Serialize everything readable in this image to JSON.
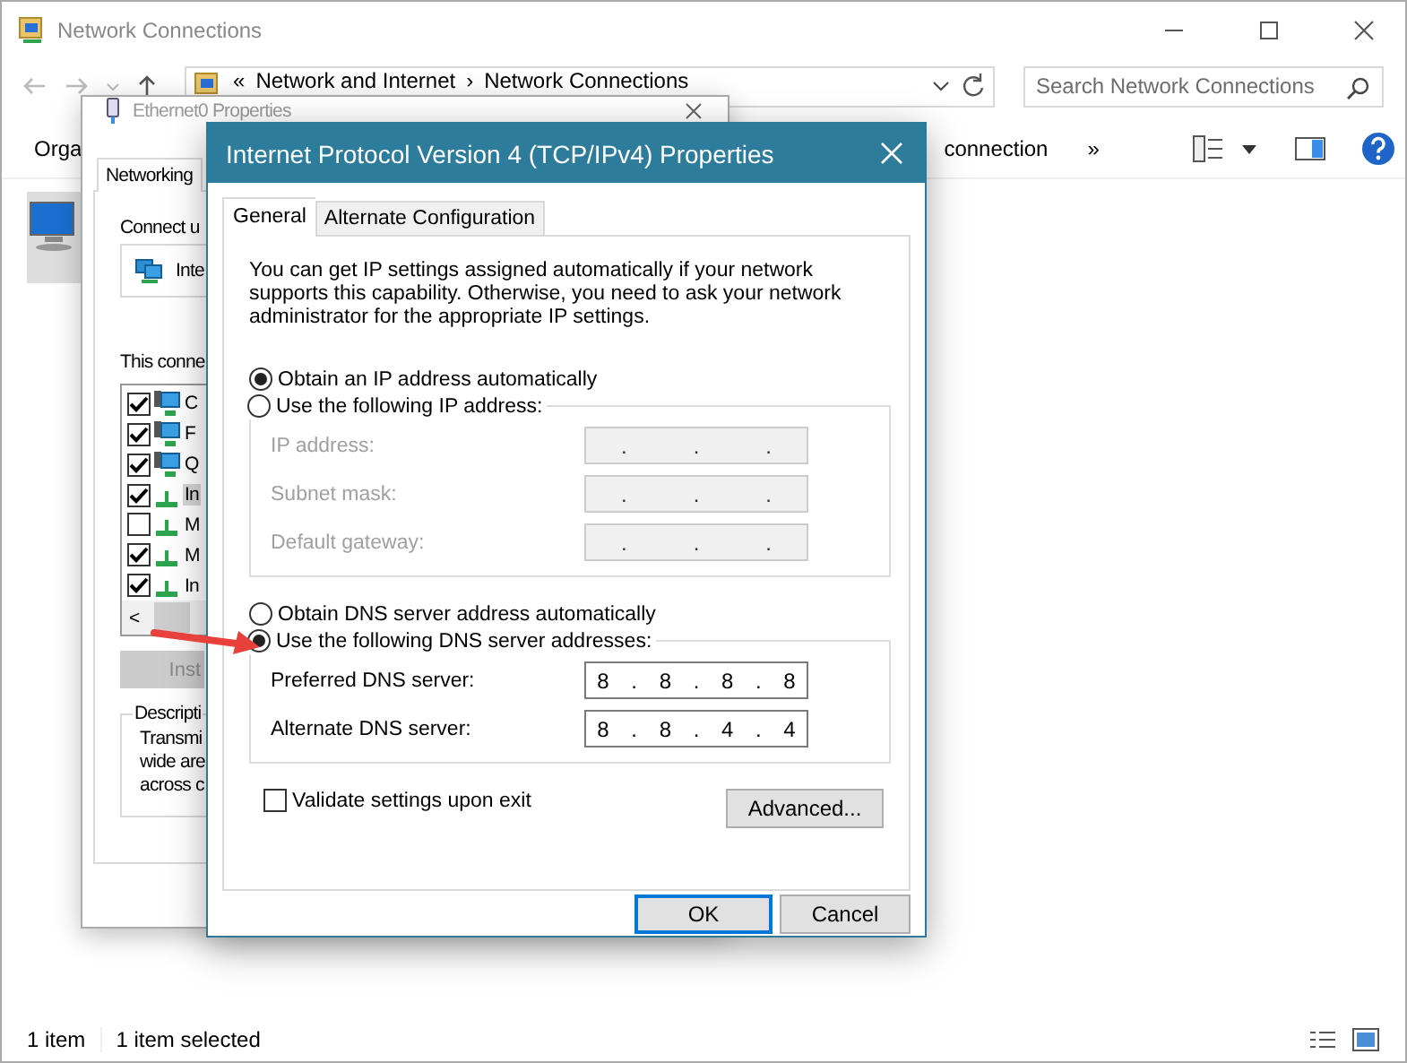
{
  "explorer": {
    "title": "Network Connections",
    "breadcrumb": [
      "«",
      "Network and Internet",
      "›",
      "Network Connections"
    ],
    "search": {
      "placeholder": "Search Network Connections"
    },
    "toolbar": [
      "Orga",
      "connection",
      "»"
    ],
    "status_bar": [
      "1 item",
      "1 item selected"
    ]
  },
  "ethernet_dialog": {
    "title": "Ethernet0 Properties",
    "tabs": [
      {
        "label": "Networking",
        "selected": true
      }
    ],
    "connect_label": "Connect u",
    "adapter": "Inte",
    "list_label": "This conne",
    "components": [
      {
        "label": "C",
        "kind": "service",
        "checked": true,
        "selected": false
      },
      {
        "label": "F",
        "kind": "service",
        "checked": true,
        "selected": false
      },
      {
        "label": "Q",
        "kind": "service",
        "checked": true,
        "selected": false
      },
      {
        "label": "In",
        "kind": "protocol",
        "checked": true,
        "selected": true
      },
      {
        "label": "M",
        "kind": "protocol",
        "checked": false,
        "selected": false
      },
      {
        "label": "M",
        "kind": "protocol",
        "checked": true,
        "selected": false
      },
      {
        "label": "In",
        "kind": "protocol",
        "checked": true,
        "selected": false
      }
    ],
    "scroll_left": "<",
    "install_button": "Inst",
    "description_label": "Descripti",
    "description": [
      "Transmi",
      "wide are",
      "across c"
    ]
  },
  "ipv4_dialog": {
    "title": "Internet Protocol Version 4 (TCP/IPv4) Properties",
    "tabs": [
      {
        "label": "General",
        "selected": true
      },
      {
        "label": "Alternate Configuration",
        "selected": false
      }
    ],
    "intro": "You can get IP settings assigned automatically if your network supports this capability. Otherwise, you need to ask your network administrator for the appropriate IP settings.",
    "ip_options": [
      {
        "label": "Obtain an IP address automatically",
        "selected": true
      },
      {
        "label": "Use the following IP address:",
        "selected": false
      }
    ],
    "ip_fields": [
      {
        "label": "IP address:",
        "placeholder": ".   .   .",
        "disabled": true
      },
      {
        "label": "Subnet mask:",
        "placeholder": ".   .   .",
        "disabled": true
      },
      {
        "label": "Default gateway:",
        "placeholder": ".   .   .",
        "disabled": true
      }
    ],
    "dns_options": [
      {
        "label": "Obtain DNS server address automatically",
        "selected": false
      },
      {
        "label": "Use the following DNS server addresses:",
        "selected": true
      }
    ],
    "dns_fields": [
      {
        "label": "Preferred DNS server:",
        "value": "8 . 8 . 8 . 8",
        "disabled": false
      },
      {
        "label": "Alternate DNS server:",
        "value": "8 . 8 . 4 . 4",
        "disabled": false
      }
    ],
    "validate": {
      "label": "Validate settings upon exit",
      "checked": false
    },
    "advanced_button": "Advanced...",
    "ok_button": "OK",
    "cancel_button": "Cancel"
  }
}
